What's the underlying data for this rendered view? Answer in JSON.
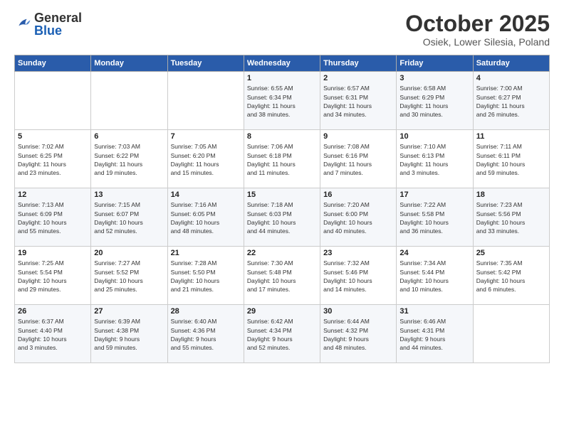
{
  "header": {
    "logo": {
      "general": "General",
      "blue": "Blue"
    },
    "title": "October 2025",
    "location": "Osiek, Lower Silesia, Poland"
  },
  "days_of_week": [
    "Sunday",
    "Monday",
    "Tuesday",
    "Wednesday",
    "Thursday",
    "Friday",
    "Saturday"
  ],
  "weeks": [
    [
      {
        "day": null,
        "info": null
      },
      {
        "day": null,
        "info": null
      },
      {
        "day": null,
        "info": null
      },
      {
        "day": "1",
        "info": "Sunrise: 6:55 AM\nSunset: 6:34 PM\nDaylight: 11 hours\nand 38 minutes."
      },
      {
        "day": "2",
        "info": "Sunrise: 6:57 AM\nSunset: 6:31 PM\nDaylight: 11 hours\nand 34 minutes."
      },
      {
        "day": "3",
        "info": "Sunrise: 6:58 AM\nSunset: 6:29 PM\nDaylight: 11 hours\nand 30 minutes."
      },
      {
        "day": "4",
        "info": "Sunrise: 7:00 AM\nSunset: 6:27 PM\nDaylight: 11 hours\nand 26 minutes."
      }
    ],
    [
      {
        "day": "5",
        "info": "Sunrise: 7:02 AM\nSunset: 6:25 PM\nDaylight: 11 hours\nand 23 minutes."
      },
      {
        "day": "6",
        "info": "Sunrise: 7:03 AM\nSunset: 6:22 PM\nDaylight: 11 hours\nand 19 minutes."
      },
      {
        "day": "7",
        "info": "Sunrise: 7:05 AM\nSunset: 6:20 PM\nDaylight: 11 hours\nand 15 minutes."
      },
      {
        "day": "8",
        "info": "Sunrise: 7:06 AM\nSunset: 6:18 PM\nDaylight: 11 hours\nand 11 minutes."
      },
      {
        "day": "9",
        "info": "Sunrise: 7:08 AM\nSunset: 6:16 PM\nDaylight: 11 hours\nand 7 minutes."
      },
      {
        "day": "10",
        "info": "Sunrise: 7:10 AM\nSunset: 6:13 PM\nDaylight: 11 hours\nand 3 minutes."
      },
      {
        "day": "11",
        "info": "Sunrise: 7:11 AM\nSunset: 6:11 PM\nDaylight: 10 hours\nand 59 minutes."
      }
    ],
    [
      {
        "day": "12",
        "info": "Sunrise: 7:13 AM\nSunset: 6:09 PM\nDaylight: 10 hours\nand 55 minutes."
      },
      {
        "day": "13",
        "info": "Sunrise: 7:15 AM\nSunset: 6:07 PM\nDaylight: 10 hours\nand 52 minutes."
      },
      {
        "day": "14",
        "info": "Sunrise: 7:16 AM\nSunset: 6:05 PM\nDaylight: 10 hours\nand 48 minutes."
      },
      {
        "day": "15",
        "info": "Sunrise: 7:18 AM\nSunset: 6:03 PM\nDaylight: 10 hours\nand 44 minutes."
      },
      {
        "day": "16",
        "info": "Sunrise: 7:20 AM\nSunset: 6:00 PM\nDaylight: 10 hours\nand 40 minutes."
      },
      {
        "day": "17",
        "info": "Sunrise: 7:22 AM\nSunset: 5:58 PM\nDaylight: 10 hours\nand 36 minutes."
      },
      {
        "day": "18",
        "info": "Sunrise: 7:23 AM\nSunset: 5:56 PM\nDaylight: 10 hours\nand 33 minutes."
      }
    ],
    [
      {
        "day": "19",
        "info": "Sunrise: 7:25 AM\nSunset: 5:54 PM\nDaylight: 10 hours\nand 29 minutes."
      },
      {
        "day": "20",
        "info": "Sunrise: 7:27 AM\nSunset: 5:52 PM\nDaylight: 10 hours\nand 25 minutes."
      },
      {
        "day": "21",
        "info": "Sunrise: 7:28 AM\nSunset: 5:50 PM\nDaylight: 10 hours\nand 21 minutes."
      },
      {
        "day": "22",
        "info": "Sunrise: 7:30 AM\nSunset: 5:48 PM\nDaylight: 10 hours\nand 17 minutes."
      },
      {
        "day": "23",
        "info": "Sunrise: 7:32 AM\nSunset: 5:46 PM\nDaylight: 10 hours\nand 14 minutes."
      },
      {
        "day": "24",
        "info": "Sunrise: 7:34 AM\nSunset: 5:44 PM\nDaylight: 10 hours\nand 10 minutes."
      },
      {
        "day": "25",
        "info": "Sunrise: 7:35 AM\nSunset: 5:42 PM\nDaylight: 10 hours\nand 6 minutes."
      }
    ],
    [
      {
        "day": "26",
        "info": "Sunrise: 6:37 AM\nSunset: 4:40 PM\nDaylight: 10 hours\nand 3 minutes."
      },
      {
        "day": "27",
        "info": "Sunrise: 6:39 AM\nSunset: 4:38 PM\nDaylight: 9 hours\nand 59 minutes."
      },
      {
        "day": "28",
        "info": "Sunrise: 6:40 AM\nSunset: 4:36 PM\nDaylight: 9 hours\nand 55 minutes."
      },
      {
        "day": "29",
        "info": "Sunrise: 6:42 AM\nSunset: 4:34 PM\nDaylight: 9 hours\nand 52 minutes."
      },
      {
        "day": "30",
        "info": "Sunrise: 6:44 AM\nSunset: 4:32 PM\nDaylight: 9 hours\nand 48 minutes."
      },
      {
        "day": "31",
        "info": "Sunrise: 6:46 AM\nSunset: 4:31 PM\nDaylight: 9 hours\nand 44 minutes."
      },
      {
        "day": null,
        "info": null
      }
    ]
  ]
}
